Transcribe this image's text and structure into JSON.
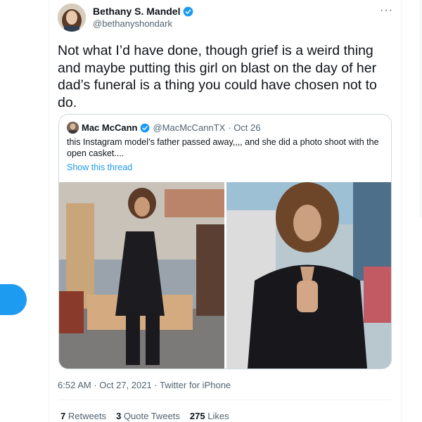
{
  "tweet": {
    "author_name": "Bethany S. Mandel",
    "author_handle": "@bethanyshondark",
    "text": "Not what I’d have done, though grief is a weird thing and maybe putting this girl on blast on the day of her dad’s funeral is a thing you could have chosen not to do.",
    "more_glyph": "···",
    "timestamp": "6:52 AM · Oct 27, 2021 · Twitter for iPhone",
    "stats": [
      {
        "count": "7",
        "label": "Retweets"
      },
      {
        "count": "3",
        "label": "Quote Tweets"
      },
      {
        "count": "275",
        "label": "Likes"
      }
    ]
  },
  "quote": {
    "author_name": "Mac McCann",
    "author_handle": "@MacMcCannTX",
    "date": "· Oct 26",
    "text": "this Instagram model’s father passed away,,,, and she did a photo shoot with the open casket....",
    "show_thread": "Show this thread"
  },
  "colors": {
    "accent": "#1d9bf0",
    "text_primary": "#0f1419",
    "text_secondary": "#536471",
    "border": "#cfd9de"
  },
  "icons": [
    "verified-badge-icon",
    "more-options-icon"
  ]
}
